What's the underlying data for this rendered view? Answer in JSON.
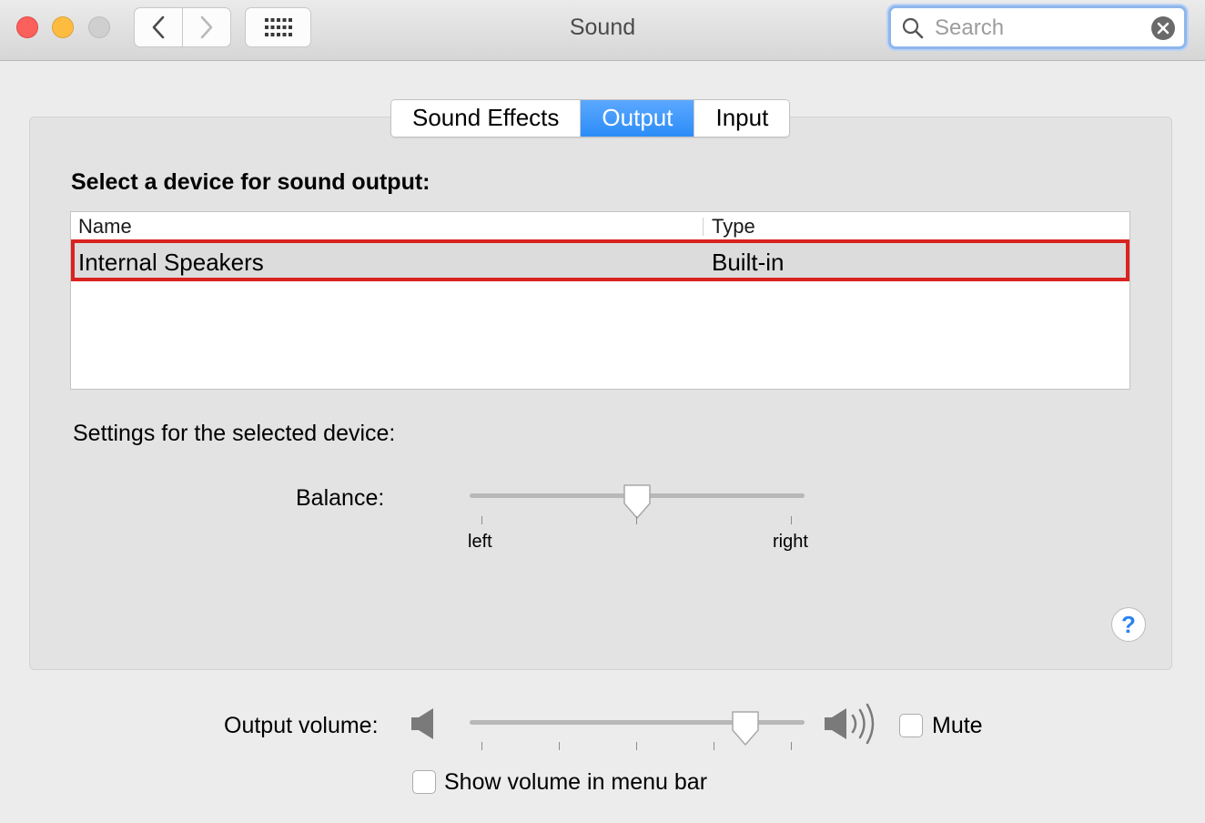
{
  "window": {
    "title": "Sound"
  },
  "search": {
    "placeholder": "Search",
    "value": ""
  },
  "tabs": [
    {
      "label": "Sound Effects",
      "active": false
    },
    {
      "label": "Output",
      "active": true
    },
    {
      "label": "Input",
      "active": false
    }
  ],
  "output": {
    "section_title": "Select a device for sound output:",
    "columns": {
      "name": "Name",
      "type": "Type"
    },
    "devices": [
      {
        "name": "Internal Speakers",
        "type": "Built-in",
        "selected": true
      }
    ],
    "settings_title": "Settings for the selected device:",
    "balance": {
      "label": "Balance:",
      "left_label": "left",
      "right_label": "right",
      "value": 0.5
    }
  },
  "volume": {
    "label": "Output volume:",
    "value": 0.85,
    "mute_label": "Mute",
    "muted": false,
    "show_in_menu_bar_label": "Show volume in menu bar",
    "show_in_menu_bar": false
  },
  "colors": {
    "accent": "#2b8cf7",
    "highlight_border": "#d9231f"
  },
  "icons": {
    "close": "close-window-icon",
    "minimize": "minimize-window-icon",
    "zoom": "zoom-window-icon",
    "back": "chevron-left-icon",
    "forward": "chevron-right-icon",
    "grid": "grid-icon",
    "search": "search-icon",
    "clear": "clear-search-icon",
    "help": "help-icon",
    "speaker_low": "speaker-low-icon",
    "speaker_high": "speaker-high-icon"
  }
}
